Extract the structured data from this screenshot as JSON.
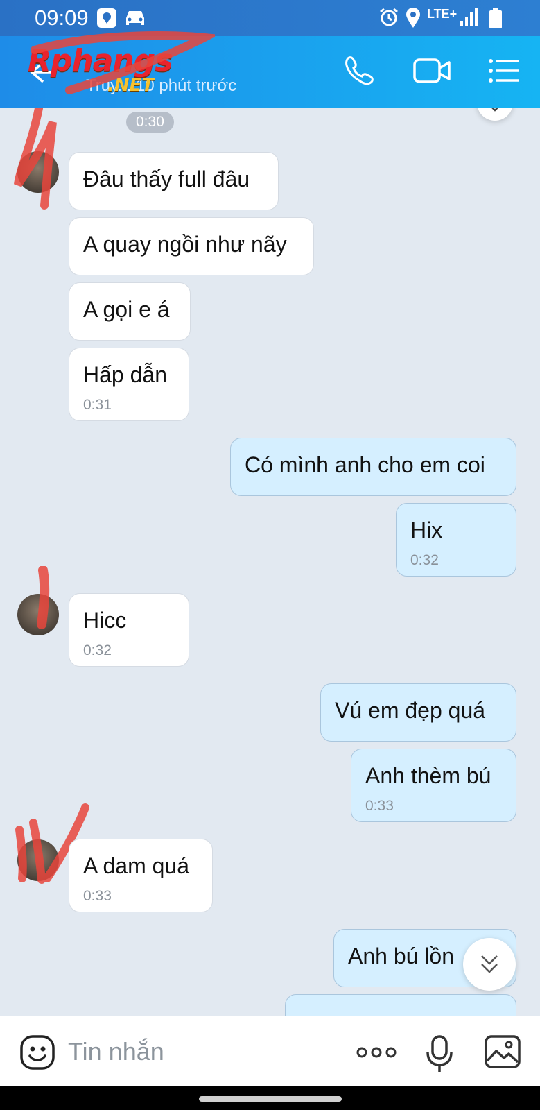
{
  "status_bar": {
    "time": "09:09",
    "network": "LTE+"
  },
  "header": {
    "back_label": "←",
    "logo_main": "Rphangs",
    "logo_net": ".NET",
    "subtitle": "Truy... 10 phút trước"
  },
  "chat": {
    "time_chip": "0:30",
    "messages": [
      {
        "text": "Đâu thấy full đâu"
      },
      {
        "text": "A quay ngồi như nãy"
      },
      {
        "text": "A gọi e á"
      },
      {
        "text": "Hấp dẫn",
        "time": "0:31"
      },
      {
        "text": "Có mình anh cho em coi"
      },
      {
        "text": "Hix",
        "time": "0:32"
      },
      {
        "text": "Hicc",
        "time": "0:32"
      },
      {
        "text": "Vú em đẹp quá"
      },
      {
        "text": "Anh thèm bú",
        "time": "0:33"
      },
      {
        "text": "A dam quá",
        "time": "0:33"
      },
      {
        "text": "Anh bú lồn"
      }
    ]
  },
  "composer": {
    "placeholder": "Tin nhắn"
  },
  "colors": {
    "header": "#1b9cf0",
    "incoming_bubble": "#ffffff",
    "outgoing_bubble": "#d5efff",
    "chat_bg": "#e2e9f1"
  }
}
